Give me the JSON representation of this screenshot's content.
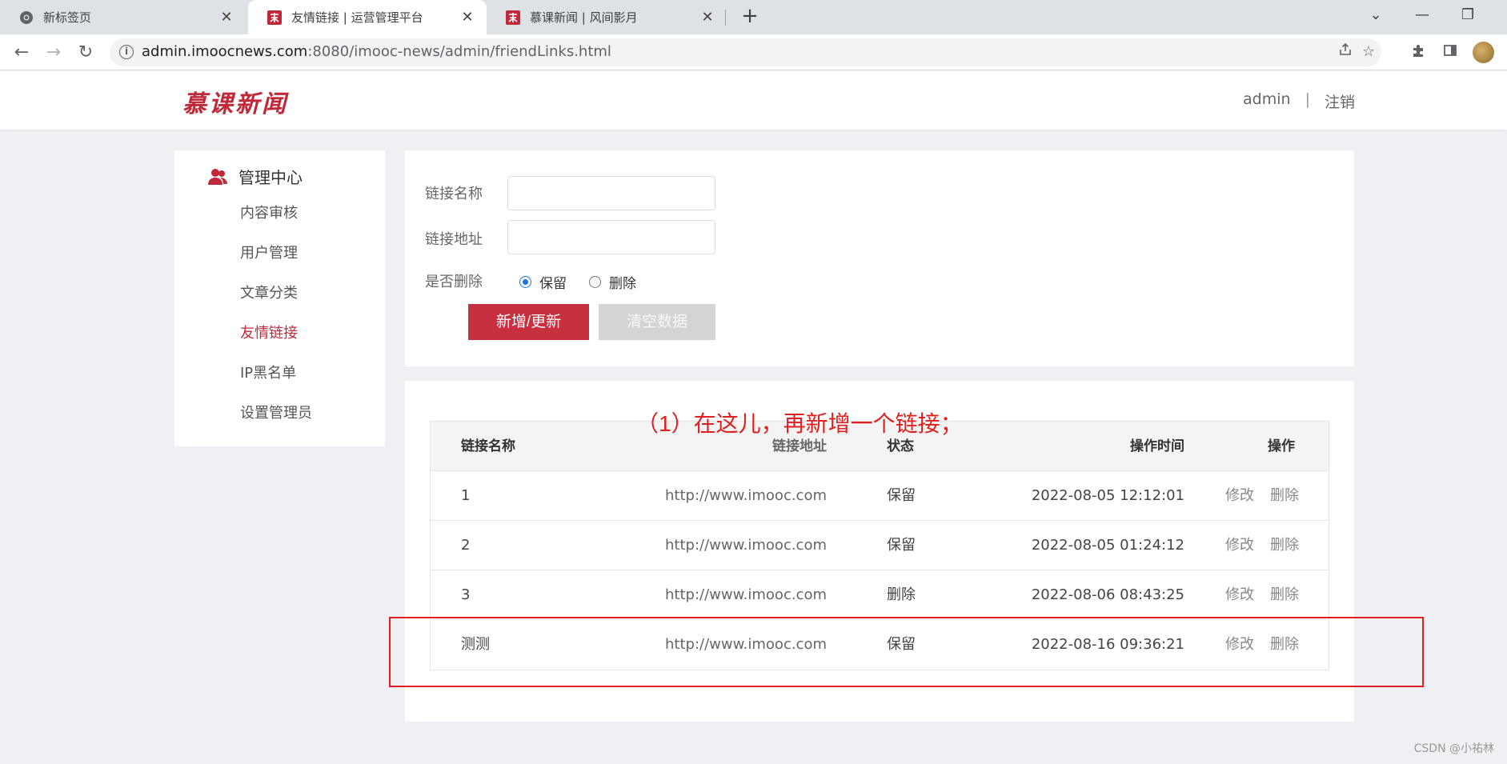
{
  "browser": {
    "tabs": [
      {
        "title": "新标签页",
        "close": "✕"
      },
      {
        "title": "友情链接 | 运营管理平台",
        "close": "✕"
      },
      {
        "title": "慕课新闻 | 风间影月",
        "close": "✕"
      }
    ],
    "new_tab_label": "+",
    "url_host": "admin.imoocnews.com",
    "url_rest": ":8080/imooc-news/admin/friendLinks.html",
    "window_controls": {
      "dropdown": "⌄",
      "minimize": "—",
      "restore": "❐",
      "close": "✕"
    },
    "nav": {
      "back": "←",
      "forward": "→",
      "reload": "↻"
    }
  },
  "header": {
    "logo": "慕课新闻",
    "user": "admin",
    "separator": "|",
    "logout": "注销"
  },
  "sidebar": {
    "title": "管理中心",
    "items": [
      {
        "label": "内容审核"
      },
      {
        "label": "用户管理"
      },
      {
        "label": "文章分类"
      },
      {
        "label": "友情链接"
      },
      {
        "label": "IP黑名单"
      },
      {
        "label": "设置管理员"
      }
    ]
  },
  "form": {
    "name_label": "链接名称",
    "name_value": "",
    "url_label": "链接地址",
    "url_value": "",
    "delete_label": "是否删除",
    "radio_keep": "保留",
    "radio_delete": "删除",
    "submit_button": "新增/更新",
    "clear_button": "清空数据"
  },
  "table": {
    "headers": {
      "name": "链接名称",
      "url": "链接地址",
      "status": "状态",
      "time": "操作时间",
      "ops": "操作"
    },
    "rows": [
      {
        "name": "1",
        "url": "http://www.imooc.com",
        "status": "保留",
        "time": "2022-08-05 12:12:01",
        "edit": "修改",
        "delete": "删除"
      },
      {
        "name": "2",
        "url": "http://www.imooc.com",
        "status": "保留",
        "time": "2022-08-05 01:24:12",
        "edit": "修改",
        "delete": "删除"
      },
      {
        "name": "3",
        "url": "http://www.imooc.com",
        "status": "删除",
        "time": "2022-08-06 08:43:25",
        "edit": "修改",
        "delete": "删除"
      },
      {
        "name": "测测",
        "url": "http://www.imooc.com",
        "status": "保留",
        "time": "2022-08-16 09:36:21",
        "edit": "修改",
        "delete": "删除"
      }
    ]
  },
  "annotation": "（1）在这儿，再新增一个链接；",
  "watermark": "CSDN @小祐林",
  "colors": {
    "brand": "#c0293a",
    "annotation": "#e02020",
    "radio": "#1a73e8"
  }
}
